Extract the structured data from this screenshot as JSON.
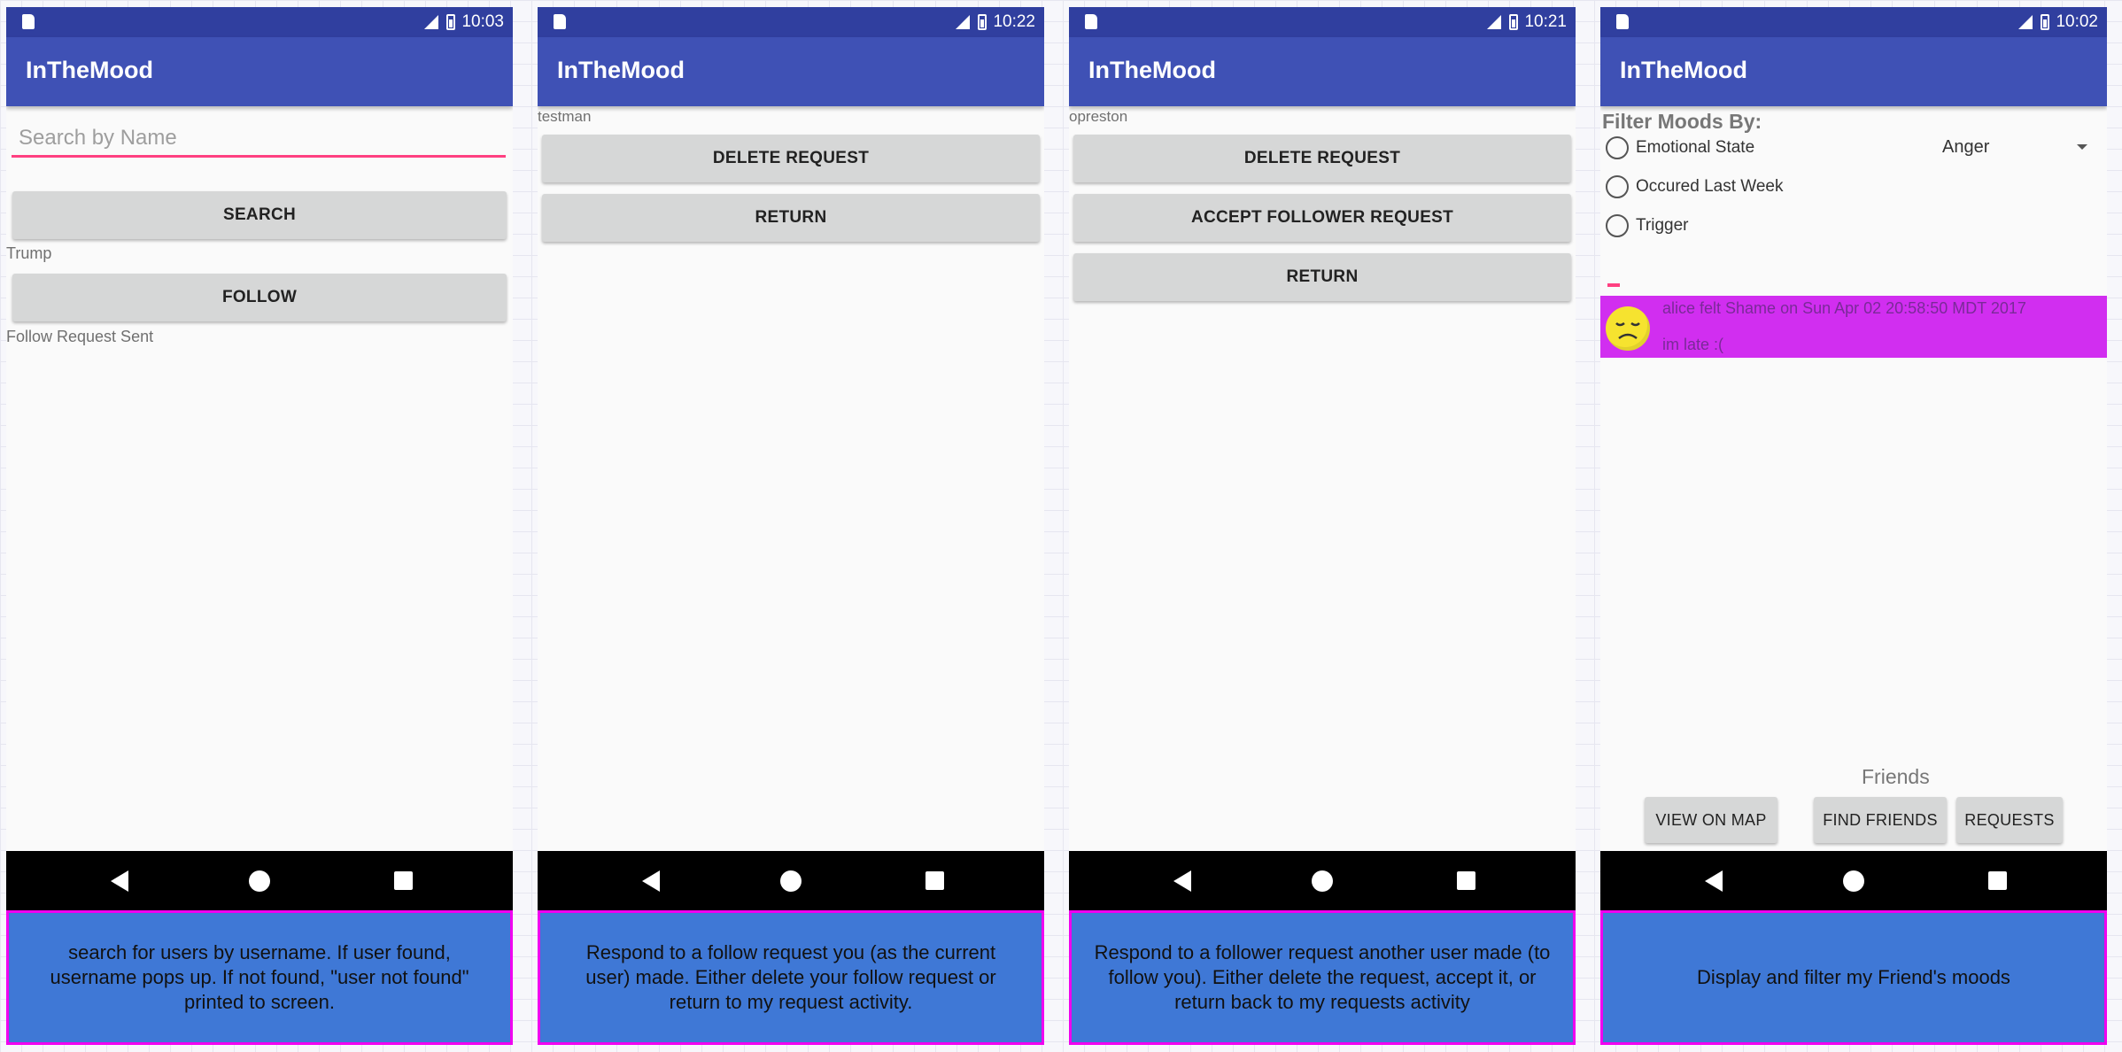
{
  "app_name": "InTheMood",
  "screens": [
    {
      "time": "10:03",
      "search": {
        "placeholder": "Search by Name",
        "value": ""
      },
      "search_button": "SEARCH",
      "found_user": "Trump",
      "follow_button": "FOLLOW",
      "status_text": "Follow Request Sent",
      "caption": "search for users by username. If user found, username pops up. If not found, \"user not found\" printed to screen."
    },
    {
      "time": "10:22",
      "username": "testman",
      "delete_button": "DELETE REQUEST",
      "return_button": "RETURN",
      "caption": "Respond to a follow request you (as the current user) made. Either delete your follow request or return to my request activity."
    },
    {
      "time": "10:21",
      "username": "opreston",
      "delete_button": "DELETE REQUEST",
      "accept_button": "ACCEPT FOLLOWER REQUEST",
      "return_button": "RETURN",
      "caption": "Respond to a follower request another user made (to follow you). Either delete the request, accept it, or return back to my requests activity"
    },
    {
      "time": "10:02",
      "filter_title": "Filter Moods By:",
      "filters": [
        "Emotional State",
        "Occured Last Week",
        "Trigger"
      ],
      "emotion_select": "Anger",
      "mood_entry": {
        "line1": "alice felt Shame on Sun Apr 02 20:58:50 MDT 2017",
        "line2": "im late :(",
        "emoji": "sad-face-icon"
      },
      "friends_label": "Friends",
      "map_button": "VIEW ON MAP",
      "find_friends_button": "FIND FRIENDS",
      "requests_button": "REQUESTS",
      "caption": "Display and filter my Friend's moods"
    }
  ],
  "colors": {
    "status_bar": "#303f9f",
    "app_bar": "#3f51b5",
    "accent": "#ff4081",
    "caption_bg": "#3f78d6",
    "caption_border": "#f000f0",
    "mood_row": "#d12ef0"
  }
}
